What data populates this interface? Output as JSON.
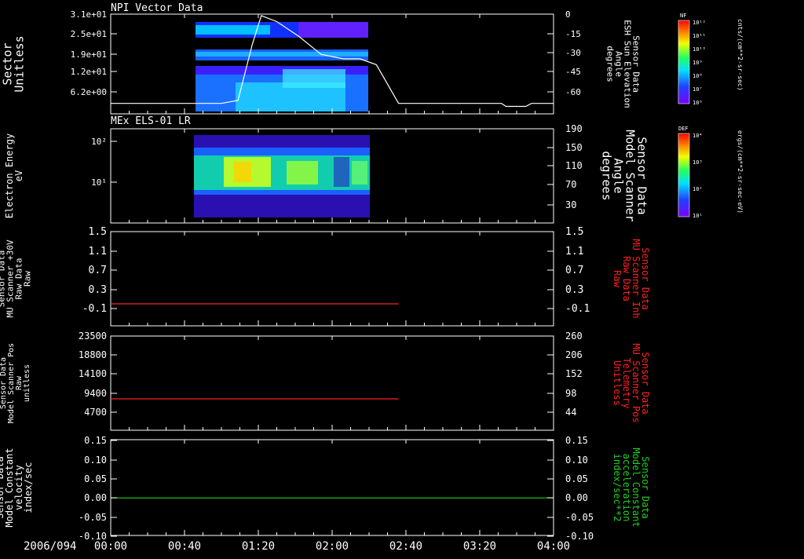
{
  "date_label": "2006/094",
  "time_ticks": [
    "00:00",
    "00:40",
    "01:20",
    "02:00",
    "02:40",
    "03:20",
    "04:00"
  ],
  "time_range_hours": [
    0,
    4
  ],
  "colors": {
    "background": "#000000",
    "axes": "#ffffff",
    "red_trace": "#ff2020",
    "green_trace": "#20d020"
  },
  "panels": [
    {
      "id": "npi",
      "title": "NPI Vector Data",
      "left_label": [
        "Sector",
        "Unitless"
      ],
      "left_ticks": [
        "3.1e+01",
        "2.5e+01",
        "1.9e+01",
        "1.2e+01",
        "6.2e+00"
      ],
      "right_label": [
        "Sensor Data",
        "ESH Sun Elevation",
        "Angle",
        "degrees"
      ],
      "right_ticks": [
        "0",
        "-15",
        "-30",
        "-45",
        "-60"
      ],
      "colorbar": {
        "title": "NF",
        "unit": "cnts/(cm**2-sr-sec)",
        "ticks": [
          "10¹²",
          "10¹¹",
          "10¹⁰",
          "10⁹",
          "10⁸",
          "10⁷",
          "10⁶"
        ]
      }
    },
    {
      "id": "els",
      "title": "MEx ELS-01 LR",
      "left_label": [
        "Electron Energy",
        "eV"
      ],
      "left_ticks": [
        "10²",
        "10¹"
      ],
      "right_label": [
        "Sensor Data",
        "Model Scanner",
        "Angle",
        "degrees"
      ],
      "right_ticks": [
        "190",
        "150",
        "110",
        "70",
        "30"
      ],
      "colorbar": {
        "title": "DEF",
        "unit": "ergs/(cm**2-sr-sec-eV)",
        "ticks": [
          "10⁴",
          "10³",
          "10²",
          "10¹"
        ]
      }
    },
    {
      "id": "mu_raw",
      "left_label": [
        "Sensor Data",
        "MU Scanner +30V",
        "Raw Data",
        "Raw"
      ],
      "left_ticks": [
        "1.5",
        "1.1",
        "0.7",
        "0.3",
        "-0.1"
      ],
      "right_label": [
        "Sensor Data",
        "MU Scanner Inh",
        "Raw Data",
        "Raw"
      ],
      "right_ticks": [
        "1.5",
        "1.1",
        "0.7",
        "0.3",
        "-0.1"
      ]
    },
    {
      "id": "pos",
      "left_label": [
        "Sensor Data",
        "Model Scanner Pos",
        "Raw",
        "unitless"
      ],
      "left_ticks": [
        "23500",
        "18800",
        "14100",
        "9400",
        "4700"
      ],
      "right_label": [
        "Sensor Data",
        "MU Scanner Pos",
        "Telemetry",
        "Unitless"
      ],
      "right_ticks": [
        "260",
        "206",
        "152",
        "98",
        "44"
      ]
    },
    {
      "id": "model",
      "left_label": [
        "Sensor Data",
        "Model Constant",
        "velocity",
        "index/sec"
      ],
      "left_ticks": [
        "0.15",
        "0.10",
        "0.05",
        "0.00",
        "-0.05",
        "-0.10"
      ],
      "right_label": [
        "Sensor Data",
        "Model Constant",
        "acceleration",
        "index/sec**2"
      ],
      "right_ticks": [
        "0.15",
        "0.10",
        "0.05",
        "0.00",
        "-0.05",
        "-0.10"
      ]
    }
  ],
  "chart_data": [
    {
      "type": "heatmap",
      "title": "NPI Vector Data",
      "ylabel": "Sector Unitless",
      "y2label": "Sensor Data ESH Sun Elevation Angle degrees",
      "y2lim": [
        -67,
        0
      ],
      "data_interval_hours": [
        0.62,
        2.57
      ],
      "series": [
        {
          "name": "ESH Sun Elevation Angle",
          "x": [
            0,
            1.0,
            1.15,
            1.28,
            1.36,
            1.5,
            1.7,
            1.9,
            2.1,
            2.25,
            2.4,
            2.6,
            2.9,
            3.3,
            3.53,
            3.57,
            3.75,
            3.8,
            4.0
          ],
          "y": [
            -60,
            -60,
            -58,
            -20,
            -1,
            -5,
            -15,
            -27,
            -30,
            -30,
            -34,
            -60,
            -60,
            -60,
            -60,
            -62,
            -62,
            -60,
            -60
          ]
        }
      ]
    },
    {
      "type": "heatmap",
      "title": "MEx ELS-01 LR",
      "ylabel": "Electron Energy eV",
      "y2label": "Sensor Data Model Scanner Angle degrees",
      "data_interval_hours": [
        0.6,
        2.58
      ]
    },
    {
      "type": "line",
      "series": [
        {
          "name": "MU Scanner Inh Raw Data",
          "x": [
            0,
            2.6
          ],
          "y": [
            -0.1,
            -0.1
          ]
        }
      ],
      "ylim": [
        -0.1,
        1.5
      ]
    },
    {
      "type": "line",
      "series": [
        {
          "name": "MU Scanner Pos Telemetry",
          "x": [
            0,
            2.6
          ],
          "y": [
            9400,
            9400
          ]
        }
      ],
      "ylim": [
        2350,
        23500
      ]
    },
    {
      "type": "line",
      "series": [
        {
          "name": "Model Constant velocity",
          "x": [
            0,
            4
          ],
          "y": [
            0.0,
            0.0
          ]
        }
      ],
      "ylim": [
        -0.1,
        0.15
      ]
    }
  ]
}
